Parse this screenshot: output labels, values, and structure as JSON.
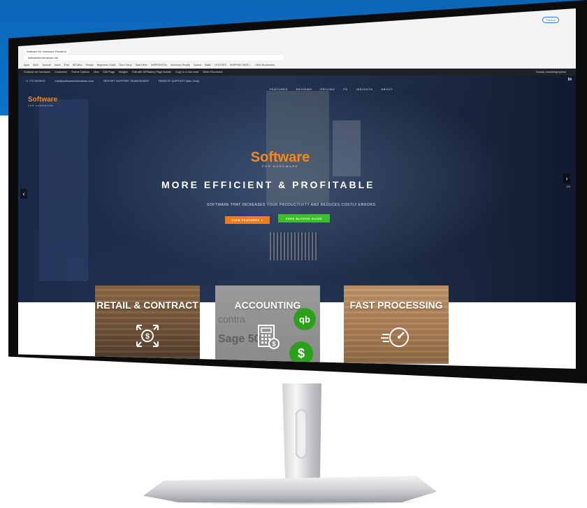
{
  "browser": {
    "tab_title": "Software for Hardware Retailers",
    "url": "softwareforhardware.net",
    "profile": "Paused",
    "bookmarks": [
      "Apps",
      "MAIL",
      "Upwork",
      "Inbox",
      "iPad",
      "MS Misc",
      "Envato",
      "Other Bookmarks",
      "Beginners Guide",
      "Don't Carry",
      "Start Here!",
      "INSPIRATION",
      "Converse Shopify",
      "Scores",
      "Baltic",
      "UTILITIES",
      "INSPIRED WEB I..."
    ],
    "other_bookmarks": "Other Bookmarks"
  },
  "wp_admin": {
    "items": [
      "Software for Hardware",
      "Customize",
      "Theme Options",
      "New",
      "Edit Page",
      "Insights",
      "Edit with WPBakery Page Builder",
      "Copy to a new draft",
      "Slider Revolution"
    ],
    "howdy": "Howdy, creativegraphics"
  },
  "site": {
    "topbar": [
      "+1 770 WORKS",
      "info@softwareforhardware.com",
      "REPORT SUPPORT TEAMVIEWER",
      "REMOTE SUPPORT (Mac Only)"
    ],
    "social": "in",
    "nav": [
      "FEATURES",
      "REVIEWS",
      "PRICING",
      "FS",
      "INSIGHTS",
      "ABOUT"
    ],
    "logo_main": "Software",
    "logo_sub": "FOR HARDWARE",
    "hero": {
      "headline": "MORE EFFICIENT & PROFITABLE",
      "tagline": "SOFTWARE THAT INCREASES YOUR PRODUCTIVITY AND REDUCES COSTLY ERRORS",
      "btn_features": "VIEW FEATURES »",
      "btn_guide": "FREE BUYERS GUIDE",
      "arrow_left": "‹",
      "arrow_right": "›",
      "slide_count": "2/3"
    },
    "cards": [
      {
        "title": "RETAIL & CONTRACT",
        "icon": "money-expand-icon"
      },
      {
        "title": "ACCOUNTING",
        "icon": "calculator-dollar-icon",
        "bg_words": [
          "contra",
          "Sage 50"
        ],
        "qb": "qb",
        "dollar": "$"
      },
      {
        "title": "FAST PROCESSING",
        "icon": "speedometer-icon"
      }
    ]
  },
  "colors": {
    "brand_orange": "#f28a1e",
    "guide_green": "#3bbf2a",
    "backdrop_blue": "#0b66b8"
  }
}
